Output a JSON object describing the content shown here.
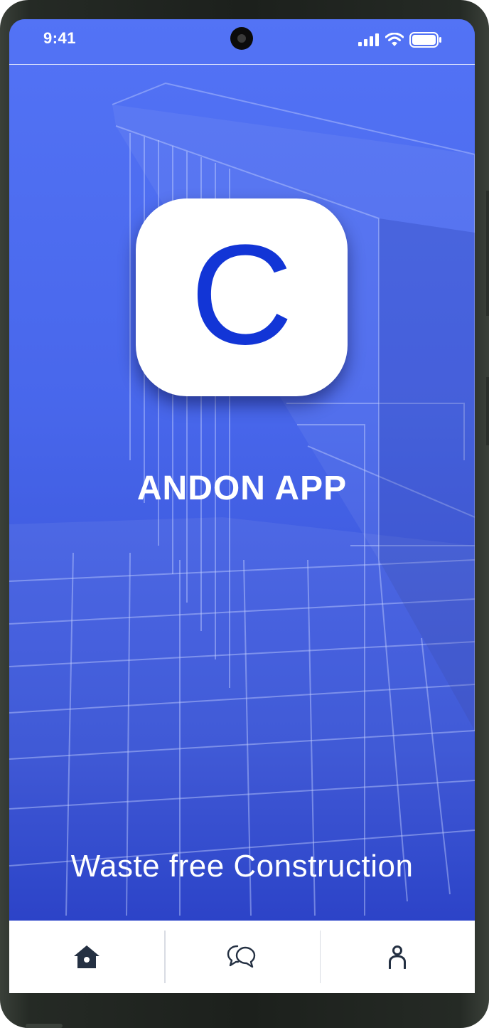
{
  "status_bar": {
    "time": "9:41",
    "icons": [
      "signal-icon",
      "wifi-icon",
      "battery-icon"
    ]
  },
  "app": {
    "icon_letter": "C",
    "icon_color": "#1235d6",
    "title": "ANDON APP",
    "tagline": "Waste free Construction"
  },
  "theme": {
    "primary": "#3d5fe6",
    "tabbar_bg": "#ffffff",
    "icon_color": "#243042"
  },
  "tabbar": {
    "items": [
      {
        "name": "home",
        "icon": "home-icon"
      },
      {
        "name": "messages",
        "icon": "chat-bubbles-icon"
      },
      {
        "name": "profile",
        "icon": "user-icon"
      }
    ]
  }
}
